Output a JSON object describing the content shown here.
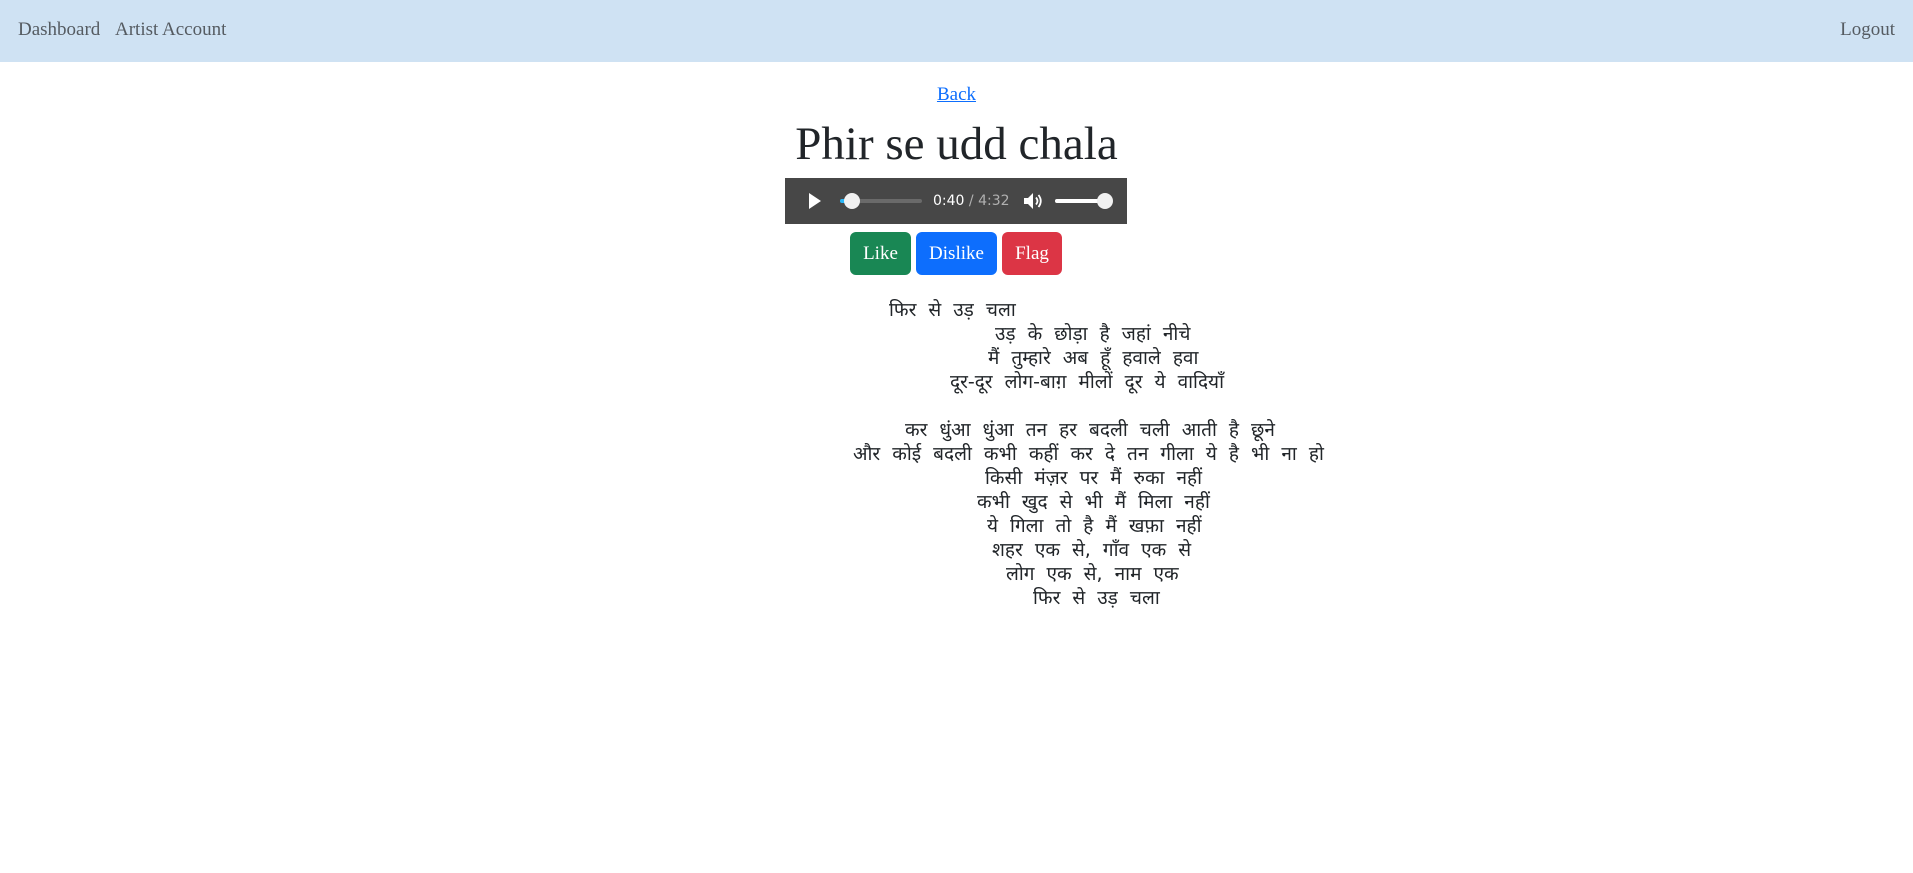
{
  "nav": {
    "dashboard": "Dashboard",
    "artist_account": "Artist Account",
    "logout": "Logout"
  },
  "back_label": "Back",
  "song": {
    "title": "Phir se udd chala"
  },
  "player": {
    "current_time": "0:40",
    "duration": "/ 4:32",
    "progress_fraction": 0.147,
    "volume_fraction": 1.0,
    "colors": {
      "background": "#474747",
      "progress": "#29b6f6"
    }
  },
  "actions": {
    "like": "Like",
    "dislike": "Dislike",
    "flag": "Flag",
    "colors": {
      "like": "#198754",
      "dislike": "#0d6efd",
      "flag": "#dc3545"
    }
  },
  "lyrics": [
    "फिर से उड़ चला",
    "उड़ के छोड़ा है जहां नीचे",
    "मैं तुम्हारे अब हूँ हवाले हवा",
    "दूर-दूर लोग-बाग़ मीलों दूर ये वादियाँ",
    "कर धुंआ धुंआ तन हर बदली चली आती है छूने",
    "और कोई बदली कभी कहीं कर दे तन गीला ये है भी ना हो",
    "किसी मंज़र पर मैं रुका नहीं",
    "कभी खुद से भी मैं मिला नहीं",
    "ये गिला तो है मैं खफ़ा नहीं",
    "शहर एक से, गाँव एक से",
    "लोग एक से, नाम एक",
    "फिर से उड़ चला"
  ]
}
